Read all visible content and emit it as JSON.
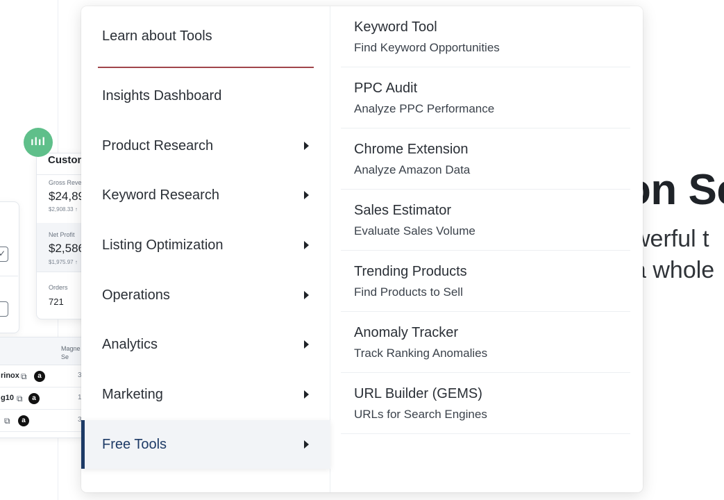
{
  "background": {
    "hero": {
      "title": "on Se",
      "subtitle_line1": "werful t",
      "subtitle_line2": "a whole"
    },
    "metrics_card": {
      "title": "Custon",
      "metrics": [
        {
          "label": "Gross Reve",
          "value": "$24,89",
          "sub": "$2,908.33 ↑"
        },
        {
          "label": "Net Profit",
          "value": "$2,586",
          "sub": "$1,975.97 ↑"
        },
        {
          "label": "Orders",
          "value": "721",
          "sub": ""
        }
      ]
    },
    "table": {
      "header": "Magne\nSe",
      "rows": [
        {
          "name": "rinox",
          "num": "3"
        },
        {
          "name": "g10",
          "num": "1"
        },
        {
          "name": "",
          "num": "3"
        }
      ]
    }
  },
  "menu": {
    "learn_label": "Learn about Tools",
    "accent_color": "#1d3a66",
    "divider_color": "#a0454a",
    "items": [
      {
        "label": "Insights Dashboard",
        "has_submenu": false,
        "active": false
      },
      {
        "label": "Product Research",
        "has_submenu": true,
        "active": false
      },
      {
        "label": "Keyword Research",
        "has_submenu": true,
        "active": false
      },
      {
        "label": "Listing Optimization",
        "has_submenu": true,
        "active": false
      },
      {
        "label": "Operations",
        "has_submenu": true,
        "active": false
      },
      {
        "label": "Analytics",
        "has_submenu": true,
        "active": false
      },
      {
        "label": "Marketing",
        "has_submenu": true,
        "active": false
      },
      {
        "label": "Free Tools",
        "has_submenu": true,
        "active": true
      }
    ],
    "tools": [
      {
        "title": "Keyword Tool",
        "subtitle": "Find Keyword Opportunities"
      },
      {
        "title": "PPC Audit",
        "subtitle": "Analyze PPC Performance"
      },
      {
        "title": "Chrome Extension",
        "subtitle": "Analyze Amazon Data"
      },
      {
        "title": "Sales Estimator",
        "subtitle": "Evaluate Sales Volume"
      },
      {
        "title": "Trending Products",
        "subtitle": "Find Products to Sell"
      },
      {
        "title": "Anomaly Tracker",
        "subtitle": "Track Ranking Anomalies"
      },
      {
        "title": "URL Builder (GEMS)",
        "subtitle": "URLs for Search Engines"
      }
    ]
  }
}
